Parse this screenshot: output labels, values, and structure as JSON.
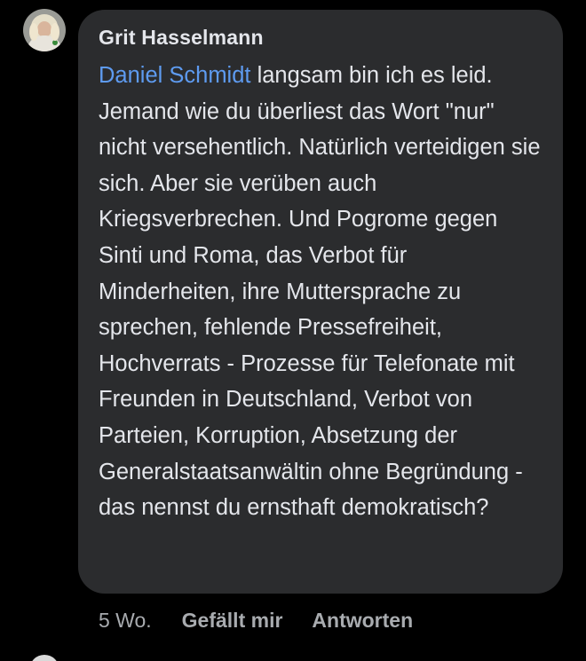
{
  "comment": {
    "author": "Grit Hasselmann",
    "mention": "Daniel Schmidt",
    "text": " langsam bin ich es leid. Jemand wie du überliest das Wort \"nur\" nicht versehentlich. Natürlich verteidigen sie sich. Aber sie verüben auch Kriegsverbrechen. Und Pogrome gegen Sinti und Roma, das Verbot für Minderheiten, ihre Muttersprache zu sprechen, fehlende Pressefreiheit, Hochverrats - Prozesse für Telefonate mit Freunden in Deutschland, Verbot von Parteien, Korruption, Absetzung der Generalstaatsanwältin ohne Begründung - das nennst du ernsthaft demokratisch?"
  },
  "actions": {
    "time": "5 Wo.",
    "like_label": "Gefällt mir",
    "reply_label": "Antworten"
  },
  "colors": {
    "background": "#000000",
    "bubble": "#2b2c2e",
    "text": "#e4e6eb",
    "mention": "#5e9bf0",
    "meta": "#a8abaf"
  },
  "icons": {
    "author_avatar": "avatar-icon",
    "next_avatar": "avatar-icon"
  }
}
